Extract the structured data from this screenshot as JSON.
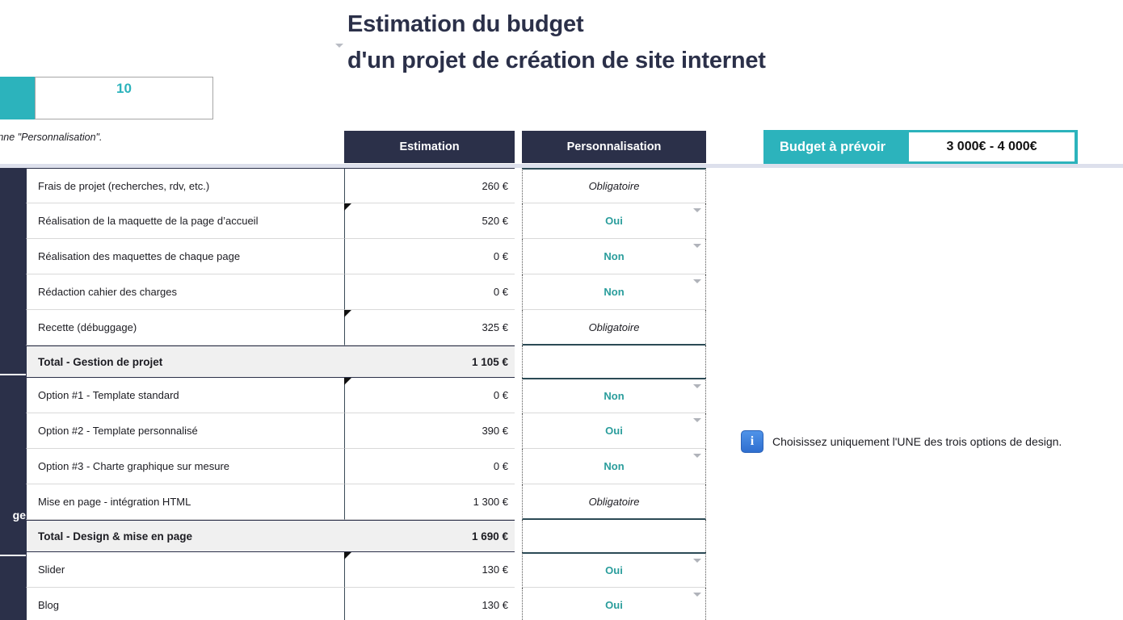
{
  "title": {
    "line1": "Estimation du budget",
    "line2": "d'un projet de création de site internet"
  },
  "counter": {
    "value": "10"
  },
  "note": "oix à partir de la colonne \"Personnalisation\".",
  "columns": {
    "estimation": "Estimation",
    "personnalisation": "Personnalisation"
  },
  "budget": {
    "label": "Budget à prévoir",
    "value": "3 000€ - 4 000€"
  },
  "category_strip": [
    {
      "label": ""
    },
    {
      "label": "ge"
    },
    {
      "label": ""
    }
  ],
  "colors": {
    "teal": "#2cb3bc",
    "navy": "#2b3049",
    "choice_teal": "#2a9d9c",
    "total_bg": "#f0f0f0",
    "info_blue": "#3f7fdc"
  },
  "rows": [
    {
      "label": "Frais de projet (recherches, rdv, etc.)",
      "amount": "260 €",
      "perso": "Obligatoire",
      "perso_type": "obligatoire",
      "kind": "item",
      "group_top": true
    },
    {
      "label": "Réalisation de la maquette de la page d’accueil",
      "amount": "520 €",
      "perso": "Oui",
      "perso_type": "choice",
      "kind": "item",
      "marker": true
    },
    {
      "label": "Réalisation des maquettes de chaque page",
      "amount": "0 €",
      "perso": "Non",
      "perso_type": "choice",
      "kind": "item"
    },
    {
      "label": "Rédaction cahier des charges",
      "amount": "0 €",
      "perso": "Non",
      "perso_type": "choice",
      "kind": "item"
    },
    {
      "label": "Recette (débuggage)",
      "amount": "325 €",
      "perso": "Obligatoire",
      "perso_type": "obligatoire",
      "kind": "item",
      "marker": true,
      "group_bottom": true
    },
    {
      "label": "Total - Gestion de projet",
      "amount": "1 105 €",
      "perso": "",
      "perso_type": "empty",
      "kind": "total"
    },
    {
      "label": "Option #1 - Template standard",
      "amount": "0 €",
      "perso": "Non",
      "perso_type": "choice",
      "kind": "item",
      "marker": true,
      "group_top": true
    },
    {
      "label": "Option #2 - Template personnalisé",
      "amount": "390 €",
      "perso": "Oui",
      "perso_type": "choice",
      "kind": "item"
    },
    {
      "label": "Option #3 - Charte graphique sur mesure",
      "amount": "0 €",
      "perso": "Non",
      "perso_type": "choice",
      "kind": "item"
    },
    {
      "label": "Mise en page - intégration HTML",
      "amount": "1 300 €",
      "perso": "Obligatoire",
      "perso_type": "obligatoire",
      "kind": "item",
      "group_bottom": true
    },
    {
      "label": "Total - Design & mise en page",
      "amount": "1 690 €",
      "perso": "",
      "perso_type": "empty",
      "kind": "total"
    },
    {
      "label": "Slider",
      "amount": "130 €",
      "perso": "Oui",
      "perso_type": "choice",
      "kind": "item",
      "marker": true,
      "group_top": true
    },
    {
      "label": "Blog",
      "amount": "130 €",
      "perso": "Oui",
      "perso_type": "choice",
      "kind": "item"
    }
  ],
  "info": {
    "icon": "info-icon",
    "text": "Choisissez uniquement l'UNE des trois options de design."
  }
}
